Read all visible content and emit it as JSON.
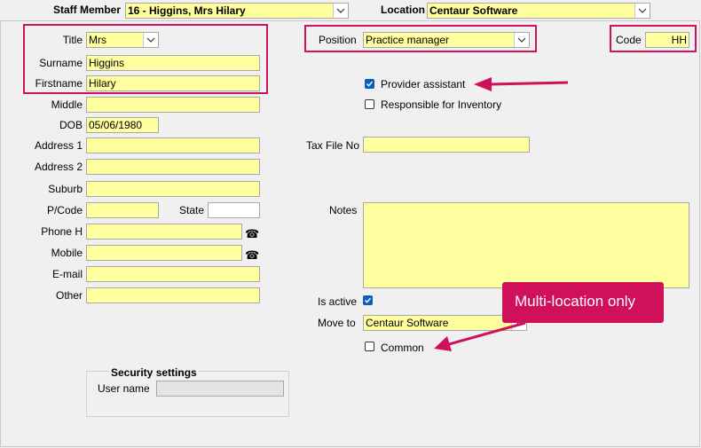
{
  "header": {
    "staff_member_label": "Staff Member",
    "staff_member_value": "16 - Higgins, Mrs Hilary",
    "location_label": "Location",
    "location_value": "Centaur Software"
  },
  "form": {
    "title_label": "Title",
    "title_value": "Mrs",
    "surname_label": "Surname",
    "surname_value": "Higgins",
    "firstname_label": "Firstname",
    "firstname_value": "Hilary",
    "middle_label": "Middle",
    "middle_value": "",
    "dob_label": "DOB",
    "dob_value": "05/06/1980",
    "address1_label": "Address 1",
    "address2_label": "Address 2",
    "suburb_label": "Suburb",
    "postcode_label": "P/Code",
    "state_label": "State",
    "phone_h_label": "Phone H",
    "mobile_label": "Mobile",
    "email_label": "E-mail",
    "other_label": "Other",
    "phone_glyph": "☎",
    "position_label": "Position",
    "position_value": "Practice manager",
    "code_label": "Code",
    "code_value": "HH",
    "provider_assistant_label": "Provider assistant",
    "provider_assistant_checked": true,
    "responsible_inventory_label": "Responsible for Inventory",
    "responsible_inventory_checked": false,
    "tax_file_label": "Tax File No",
    "notes_label": "Notes",
    "is_active_label": "Is active",
    "is_active_checked": true,
    "move_to_label": "Move to",
    "move_to_value": "Centaur Software",
    "common_label": "Common",
    "common_checked": false
  },
  "security": {
    "title": "Security settings",
    "user_name_label": "User name",
    "user_name_value": ""
  },
  "annotations": {
    "callout_text": "Multi-location only",
    "highlight_color": "#d0105a"
  },
  "colors": {
    "field_fill": "#ffffa0",
    "checkbox_checked": "#0a5fbd",
    "background": "#f0f0f0"
  }
}
